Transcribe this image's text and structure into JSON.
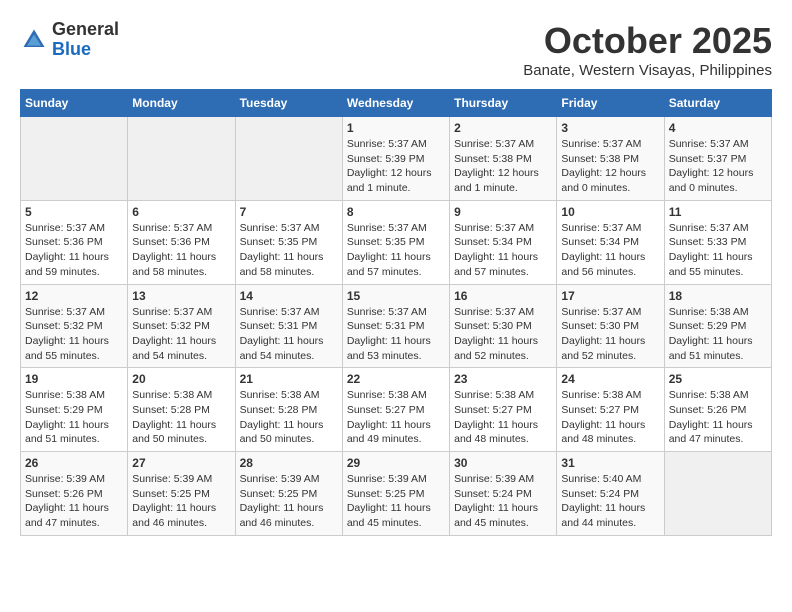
{
  "header": {
    "logo_general": "General",
    "logo_blue": "Blue",
    "month": "October 2025",
    "location": "Banate, Western Visayas, Philippines"
  },
  "weekdays": [
    "Sunday",
    "Monday",
    "Tuesday",
    "Wednesday",
    "Thursday",
    "Friday",
    "Saturday"
  ],
  "weeks": [
    [
      {
        "day": "",
        "info": ""
      },
      {
        "day": "",
        "info": ""
      },
      {
        "day": "",
        "info": ""
      },
      {
        "day": "1",
        "info": "Sunrise: 5:37 AM\nSunset: 5:39 PM\nDaylight: 12 hours\nand 1 minute."
      },
      {
        "day": "2",
        "info": "Sunrise: 5:37 AM\nSunset: 5:38 PM\nDaylight: 12 hours\nand 1 minute."
      },
      {
        "day": "3",
        "info": "Sunrise: 5:37 AM\nSunset: 5:38 PM\nDaylight: 12 hours\nand 0 minutes."
      },
      {
        "day": "4",
        "info": "Sunrise: 5:37 AM\nSunset: 5:37 PM\nDaylight: 12 hours\nand 0 minutes."
      }
    ],
    [
      {
        "day": "5",
        "info": "Sunrise: 5:37 AM\nSunset: 5:36 PM\nDaylight: 11 hours\nand 59 minutes."
      },
      {
        "day": "6",
        "info": "Sunrise: 5:37 AM\nSunset: 5:36 PM\nDaylight: 11 hours\nand 58 minutes."
      },
      {
        "day": "7",
        "info": "Sunrise: 5:37 AM\nSunset: 5:35 PM\nDaylight: 11 hours\nand 58 minutes."
      },
      {
        "day": "8",
        "info": "Sunrise: 5:37 AM\nSunset: 5:35 PM\nDaylight: 11 hours\nand 57 minutes."
      },
      {
        "day": "9",
        "info": "Sunrise: 5:37 AM\nSunset: 5:34 PM\nDaylight: 11 hours\nand 57 minutes."
      },
      {
        "day": "10",
        "info": "Sunrise: 5:37 AM\nSunset: 5:34 PM\nDaylight: 11 hours\nand 56 minutes."
      },
      {
        "day": "11",
        "info": "Sunrise: 5:37 AM\nSunset: 5:33 PM\nDaylight: 11 hours\nand 55 minutes."
      }
    ],
    [
      {
        "day": "12",
        "info": "Sunrise: 5:37 AM\nSunset: 5:32 PM\nDaylight: 11 hours\nand 55 minutes."
      },
      {
        "day": "13",
        "info": "Sunrise: 5:37 AM\nSunset: 5:32 PM\nDaylight: 11 hours\nand 54 minutes."
      },
      {
        "day": "14",
        "info": "Sunrise: 5:37 AM\nSunset: 5:31 PM\nDaylight: 11 hours\nand 54 minutes."
      },
      {
        "day": "15",
        "info": "Sunrise: 5:37 AM\nSunset: 5:31 PM\nDaylight: 11 hours\nand 53 minutes."
      },
      {
        "day": "16",
        "info": "Sunrise: 5:37 AM\nSunset: 5:30 PM\nDaylight: 11 hours\nand 52 minutes."
      },
      {
        "day": "17",
        "info": "Sunrise: 5:37 AM\nSunset: 5:30 PM\nDaylight: 11 hours\nand 52 minutes."
      },
      {
        "day": "18",
        "info": "Sunrise: 5:38 AM\nSunset: 5:29 PM\nDaylight: 11 hours\nand 51 minutes."
      }
    ],
    [
      {
        "day": "19",
        "info": "Sunrise: 5:38 AM\nSunset: 5:29 PM\nDaylight: 11 hours\nand 51 minutes."
      },
      {
        "day": "20",
        "info": "Sunrise: 5:38 AM\nSunset: 5:28 PM\nDaylight: 11 hours\nand 50 minutes."
      },
      {
        "day": "21",
        "info": "Sunrise: 5:38 AM\nSunset: 5:28 PM\nDaylight: 11 hours\nand 50 minutes."
      },
      {
        "day": "22",
        "info": "Sunrise: 5:38 AM\nSunset: 5:27 PM\nDaylight: 11 hours\nand 49 minutes."
      },
      {
        "day": "23",
        "info": "Sunrise: 5:38 AM\nSunset: 5:27 PM\nDaylight: 11 hours\nand 48 minutes."
      },
      {
        "day": "24",
        "info": "Sunrise: 5:38 AM\nSunset: 5:27 PM\nDaylight: 11 hours\nand 48 minutes."
      },
      {
        "day": "25",
        "info": "Sunrise: 5:38 AM\nSunset: 5:26 PM\nDaylight: 11 hours\nand 47 minutes."
      }
    ],
    [
      {
        "day": "26",
        "info": "Sunrise: 5:39 AM\nSunset: 5:26 PM\nDaylight: 11 hours\nand 47 minutes."
      },
      {
        "day": "27",
        "info": "Sunrise: 5:39 AM\nSunset: 5:25 PM\nDaylight: 11 hours\nand 46 minutes."
      },
      {
        "day": "28",
        "info": "Sunrise: 5:39 AM\nSunset: 5:25 PM\nDaylight: 11 hours\nand 46 minutes."
      },
      {
        "day": "29",
        "info": "Sunrise: 5:39 AM\nSunset: 5:25 PM\nDaylight: 11 hours\nand 45 minutes."
      },
      {
        "day": "30",
        "info": "Sunrise: 5:39 AM\nSunset: 5:24 PM\nDaylight: 11 hours\nand 45 minutes."
      },
      {
        "day": "31",
        "info": "Sunrise: 5:40 AM\nSunset: 5:24 PM\nDaylight: 11 hours\nand 44 minutes."
      },
      {
        "day": "",
        "info": ""
      }
    ]
  ]
}
